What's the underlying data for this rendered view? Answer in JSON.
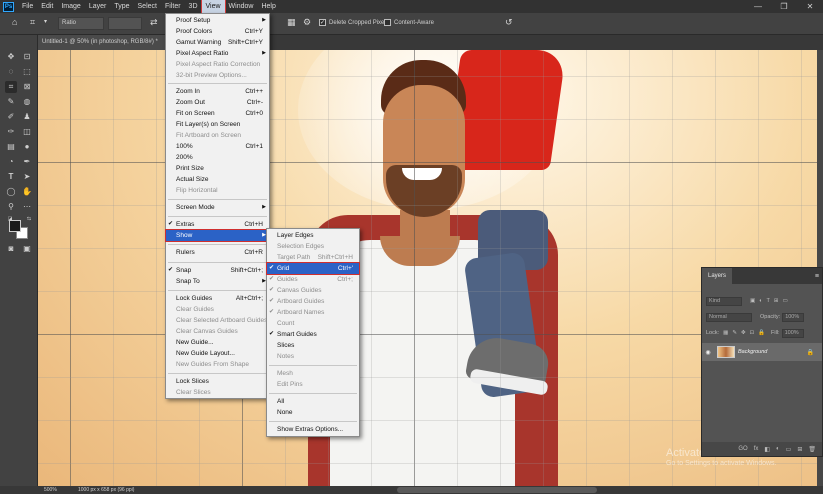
{
  "menubar": {
    "logo": "Ps",
    "items": [
      "File",
      "Edit",
      "Image",
      "Layer",
      "Type",
      "Select",
      "Filter",
      "3D",
      "View",
      "Window",
      "Help"
    ],
    "active": "View",
    "window_controls": [
      "—",
      "❐",
      "✕"
    ]
  },
  "options": {
    "ratio_label": "Ratio",
    "delete_cropped": "Delete Cropped Pixels",
    "content_aware": "Content-Aware"
  },
  "document": {
    "tab_label": "Untitled-1 @ 50% (in photoshop, RGB/8#) *"
  },
  "status": {
    "zoom": "500%",
    "doc_size": "1000 px x 658 px (96 ppi)"
  },
  "watermark": {
    "line1": "Activate Windows",
    "line2": "Go to Settings to activate Windows."
  },
  "layers_panel": {
    "tab": "Layers",
    "kind_placeholder": "Kind",
    "blend_mode": "Normal",
    "opacity_label": "Opacity:",
    "opacity_value": "100%",
    "lock_label": "Lock:",
    "fill_label": "Fill:",
    "fill_value": "100%",
    "layer_name": "Background",
    "footer_icons": [
      "GO",
      "fx",
      "◧",
      "◐",
      "▭",
      "⊞",
      "🗑"
    ]
  },
  "view_menu": {
    "items": [
      {
        "label": "Proof Setup",
        "arrow": true
      },
      {
        "label": "Proof Colors",
        "shortcut": "Ctrl+Y"
      },
      {
        "label": "Gamut Warning",
        "shortcut": "Shift+Ctrl+Y"
      },
      {
        "label": "Pixel Aspect Ratio",
        "arrow": true
      },
      {
        "label": "Pixel Aspect Ratio Correction",
        "disabled": true
      },
      {
        "label": "32-bit Preview Options...",
        "disabled": true
      },
      {
        "label": "Zoom In",
        "shortcut": "Ctrl++"
      },
      {
        "label": "Zoom Out",
        "shortcut": "Ctrl+-"
      },
      {
        "label": "Fit on Screen",
        "shortcut": "Ctrl+0"
      },
      {
        "label": "Fit Layer(s) on Screen"
      },
      {
        "label": "Fit Artboard on Screen",
        "disabled": true
      },
      {
        "label": "100%",
        "shortcut": "Ctrl+1"
      },
      {
        "label": "200%"
      },
      {
        "label": "Print Size"
      },
      {
        "label": "Actual Size"
      },
      {
        "label": "Flip Horizontal",
        "disabled": true
      },
      {
        "label": "Screen Mode",
        "arrow": true
      },
      {
        "label": "Extras",
        "shortcut": "Ctrl+H",
        "checked": true
      },
      {
        "label": "Show",
        "arrow": true,
        "highlight": true
      },
      {
        "label": "Rulers",
        "shortcut": "Ctrl+R"
      },
      {
        "label": "Snap",
        "shortcut": "Shift+Ctrl+;",
        "checked": true
      },
      {
        "label": "Snap To",
        "arrow": true
      },
      {
        "label": "Lock Guides",
        "shortcut": "Alt+Ctrl+;"
      },
      {
        "label": "Clear Guides",
        "disabled": true
      },
      {
        "label": "Clear Selected Artboard Guides",
        "disabled": true
      },
      {
        "label": "Clear Canvas Guides",
        "disabled": true
      },
      {
        "label": "New Guide..."
      },
      {
        "label": "New Guide Layout..."
      },
      {
        "label": "New Guides From Shape",
        "disabled": true
      },
      {
        "label": "Lock Slices"
      },
      {
        "label": "Clear Slices",
        "disabled": true
      }
    ]
  },
  "show_menu": {
    "items": [
      {
        "label": "Layer Edges"
      },
      {
        "label": "Selection Edges",
        "disabled": true
      },
      {
        "label": "Target Path",
        "shortcut": "Shift+Ctrl+H",
        "disabled": true
      },
      {
        "label": "Grid",
        "shortcut": "Ctrl+'",
        "checked": true,
        "highlight": true
      },
      {
        "label": "Guides",
        "shortcut": "Ctrl+;",
        "checked": true,
        "disabled": true
      },
      {
        "label": "Canvas Guides",
        "checked": true,
        "disabled": true
      },
      {
        "label": "Artboard Guides",
        "checked": true,
        "disabled": true
      },
      {
        "label": "Artboard Names",
        "checked": true,
        "disabled": true
      },
      {
        "label": "Count",
        "disabled": true
      },
      {
        "label": "Smart Guides",
        "checked": true
      },
      {
        "label": "Slices"
      },
      {
        "label": "Notes",
        "disabled": true
      },
      {
        "label": "Mesh",
        "disabled": true
      },
      {
        "label": "Edit Pins",
        "disabled": true
      },
      {
        "label": "All"
      },
      {
        "label": "None"
      },
      {
        "label": "Show Extras Options..."
      }
    ]
  }
}
